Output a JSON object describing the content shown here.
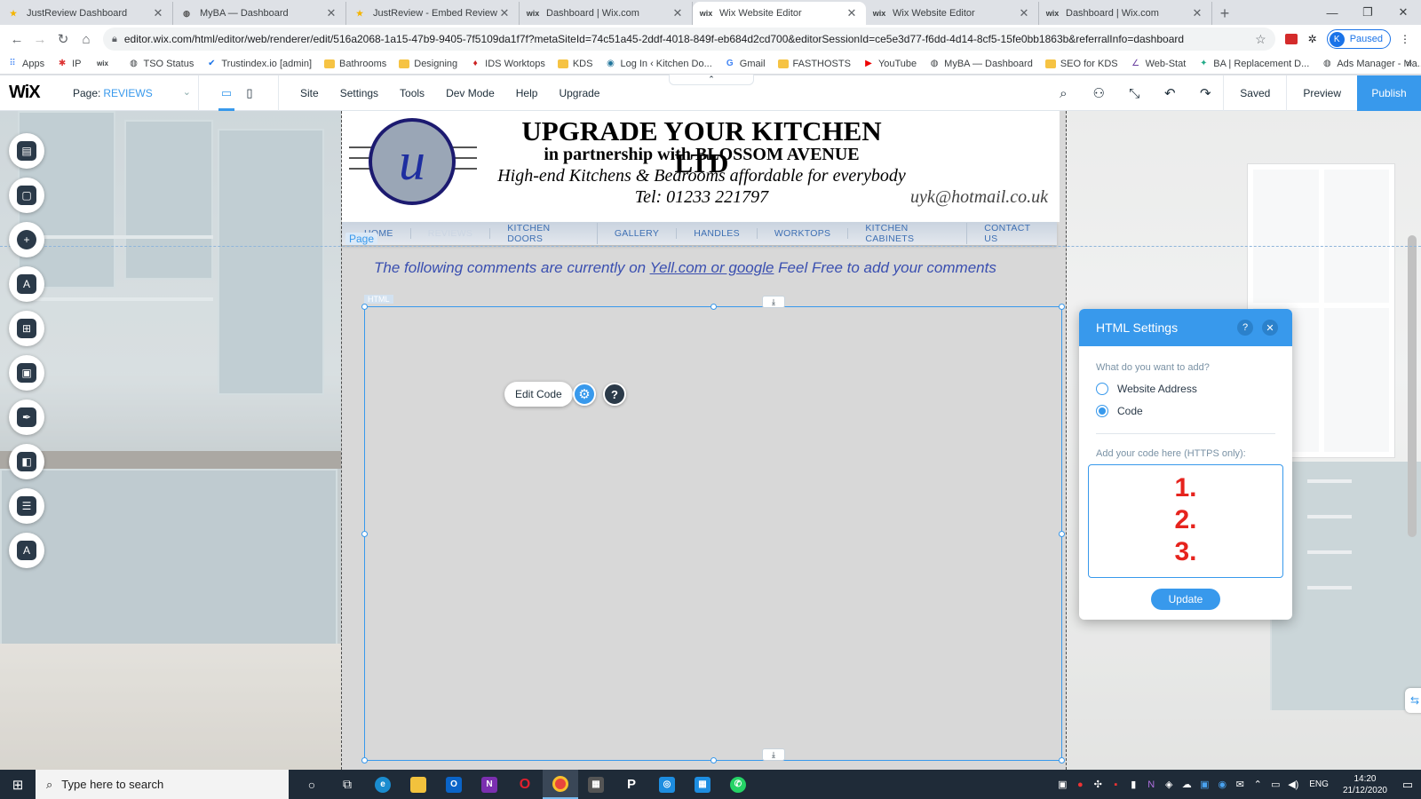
{
  "browser": {
    "tabs": [
      {
        "title": "JustReview Dashboard",
        "icon": "star-icon",
        "active": false
      },
      {
        "title": "MyBA — Dashboard",
        "icon": "globe-icon",
        "active": false
      },
      {
        "title": "JustReview - Embed Reviews On",
        "icon": "star-icon",
        "active": false
      },
      {
        "title": "Dashboard | Wix.com",
        "icon": "wix-icon",
        "active": false
      },
      {
        "title": "Wix Website Editor",
        "icon": "wix-icon",
        "active": true
      },
      {
        "title": "Wix Website Editor",
        "icon": "wix-icon",
        "active": false
      },
      {
        "title": "Dashboard | Wix.com",
        "icon": "wix-icon",
        "active": false
      }
    ],
    "url": "editor.wix.com/html/editor/web/renderer/edit/516a2068-1a15-47b9-9405-7f5109da1f7f?metaSiteId=74c51a45-2ddf-4018-849f-eb684d2cd700&editorSessionId=ce5e3d77-f6dd-4d14-8cf5-15fe0bb1863b&referralInfo=dashboard",
    "profile_initial": "K",
    "profile_status": "Paused",
    "bookmarks": [
      {
        "label": "Apps",
        "icon": "apps-grid-icon"
      },
      {
        "label": "IP",
        "icon": "ip-icon"
      },
      {
        "label": "",
        "icon": "wix-icon"
      },
      {
        "label": "TSO Status",
        "icon": "globe-icon"
      },
      {
        "label": "Trustindex.io [admin]",
        "icon": "check-icon"
      },
      {
        "label": "Bathrooms",
        "icon": "folder-icon"
      },
      {
        "label": "Designing",
        "icon": "folder-icon"
      },
      {
        "label": "IDS Worktops",
        "icon": "ids-icon"
      },
      {
        "label": "KDS",
        "icon": "folder-icon"
      },
      {
        "label": "Log In ‹ Kitchen Do...",
        "icon": "wordpress-icon"
      },
      {
        "label": "Gmail",
        "icon": "google-icon"
      },
      {
        "label": "FASTHOSTS",
        "icon": "folder-icon"
      },
      {
        "label": "YouTube",
        "icon": "youtube-icon"
      },
      {
        "label": "MyBA — Dashboard",
        "icon": "globe-icon"
      },
      {
        "label": "SEO for KDS",
        "icon": "folder-icon"
      },
      {
        "label": "Web-Stat",
        "icon": "webstat-icon"
      },
      {
        "label": "BA | Replacement D...",
        "icon": "ba-icon"
      },
      {
        "label": "Ads Manager - Ma...",
        "icon": "globe-icon"
      }
    ]
  },
  "wix": {
    "logo": "WiX",
    "page_prefix": "Page:",
    "page_name": "REVIEWS",
    "menu": [
      "Site",
      "Settings",
      "Tools",
      "Dev Mode",
      "Help",
      "Upgrade"
    ],
    "saved": "Saved",
    "preview": "Preview",
    "publish": "Publish"
  },
  "site": {
    "company": "UPGRADE YOUR KITCHEN LTD",
    "partnership": "in partnership with BLOSSOM AVENUE",
    "tagline": "High-end Kitchens & Bedrooms affordable for everybody",
    "tel": "Tel: 01233 221797",
    "email": "uyk@hotmail.co.uk",
    "logo_letter": "u",
    "nav": [
      "HOME",
      "REVIEWS",
      "KITCHEN DOORS",
      "GALLERY",
      "HANDLES",
      "WORKTOPS",
      "KITCHEN CABINETS",
      "CONTACT US"
    ],
    "page_label": "Page",
    "comment_before": "The following comments are currently on ",
    "comment_link": "Yell.com or google",
    "comment_after": " Feel Free to add your comments",
    "html_tag": "HTML",
    "edit_code": "Edit Code"
  },
  "panel": {
    "title": "HTML Settings",
    "question": "What do you want to add?",
    "options": [
      "Website Address",
      "Code"
    ],
    "selected": "Code",
    "code_label": "Add your code here (HTTPS only):",
    "code_steps": [
      "1.",
      "2.",
      "3."
    ],
    "update": "Update"
  },
  "taskbar": {
    "search_placeholder": "Type here to search",
    "lang": "ENG",
    "time": "14:20",
    "date": "21/12/2020"
  },
  "colors": {
    "wix_blue": "#3899ec",
    "step_red": "#e6231d",
    "nav_text": "#3d6fb3"
  }
}
